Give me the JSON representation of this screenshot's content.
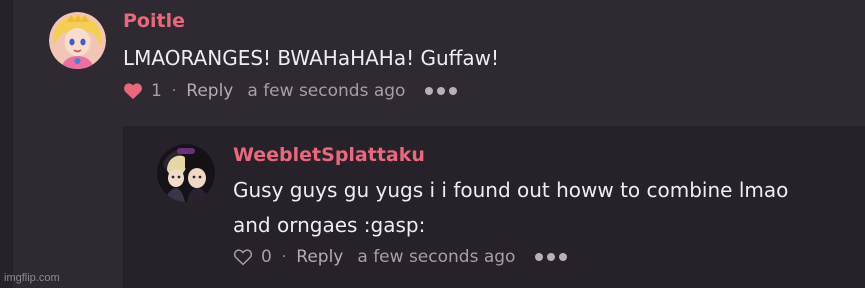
{
  "comments": [
    {
      "author": "Poitle",
      "text_lines": [
        "LMAORANGES! BWAHaHAHa! Guffaw!"
      ],
      "likes": "1",
      "liked": true,
      "reply_label": "Reply",
      "separator": "·",
      "timestamp": "a few seconds ago",
      "avatar_icon": "princess-peach-avatar-icon"
    },
    {
      "author": "WeebletSplattaku",
      "text_lines": [
        "Gusy guys gu yugs i i found out howw to combine lmao",
        "and orngaes :gasp:"
      ],
      "likes": "0",
      "liked": false,
      "reply_label": "Reply",
      "separator": "·",
      "timestamp": "a few seconds ago",
      "avatar_icon": "anime-characters-avatar-icon"
    }
  ],
  "watermark": "imgflip.com",
  "colors": {
    "background": "#2f2932",
    "reply_panel": "#272229",
    "author": "#e8697e",
    "text": "#f0ecf1",
    "meta": "#a69ea9",
    "heart_liked": "#e8697e"
  }
}
